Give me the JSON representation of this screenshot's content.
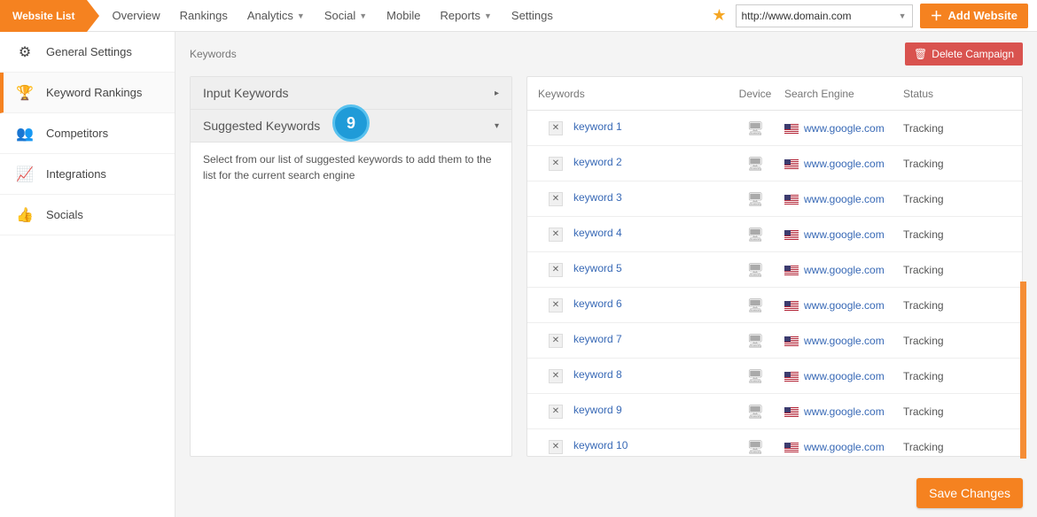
{
  "topnav": {
    "website_list": "Website List",
    "items": [
      "Overview",
      "Rankings",
      "Analytics",
      "Social",
      "Mobile",
      "Reports",
      "Settings"
    ],
    "dropdown_indices": [
      2,
      3,
      5
    ],
    "domain": "http://www.domain.com",
    "add_website": "Add Website"
  },
  "sidebar": {
    "items": [
      {
        "icon": "⚙",
        "label": "General Settings"
      },
      {
        "icon": "🏆",
        "label": "Keyword Rankings"
      },
      {
        "icon": "👥",
        "label": "Competitors"
      },
      {
        "icon": "📈",
        "label": "Integrations"
      },
      {
        "icon": "👍",
        "label": "Socials"
      }
    ],
    "active_index": 1
  },
  "breadcrumb": "Keywords",
  "delete_btn": "Delete Campaign",
  "left_panel": {
    "input_kw": "Input Keywords",
    "suggested_kw": "Suggested Keywords",
    "badge": "9",
    "desc": "Select from our list of suggested keywords to add them to the list for the current search engine"
  },
  "table": {
    "headers": {
      "keywords": "Keywords",
      "device": "Device",
      "search_engine": "Search Engine",
      "status": "Status"
    },
    "rows": [
      {
        "kw": "keyword 1",
        "se": "www.google.com",
        "status": "Tracking"
      },
      {
        "kw": "keyword 2",
        "se": "www.google.com",
        "status": "Tracking"
      },
      {
        "kw": "keyword 3",
        "se": "www.google.com",
        "status": "Tracking"
      },
      {
        "kw": "keyword 4",
        "se": "www.google.com",
        "status": "Tracking"
      },
      {
        "kw": "keyword 5",
        "se": "www.google.com",
        "status": "Tracking"
      },
      {
        "kw": "keyword 6",
        "se": "www.google.com",
        "status": "Tracking"
      },
      {
        "kw": "keyword 7",
        "se": "www.google.com",
        "status": "Tracking"
      },
      {
        "kw": "keyword 8",
        "se": "www.google.com",
        "status": "Tracking"
      },
      {
        "kw": "keyword 9",
        "se": "www.google.com",
        "status": "Tracking"
      },
      {
        "kw": "keyword 10",
        "se": "www.google.com",
        "status": "Tracking"
      }
    ]
  },
  "save_btn": "Save Changes"
}
